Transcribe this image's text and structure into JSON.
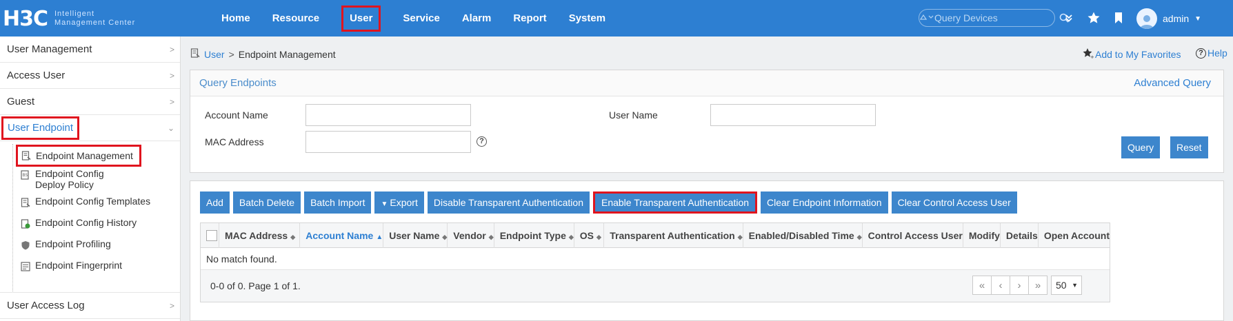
{
  "header": {
    "logo_main": "H3C",
    "logo_sub_line1": "Intelligent",
    "logo_sub_line2": "Management Center",
    "nav": [
      {
        "label": "Home",
        "active": false
      },
      {
        "label": "Resource",
        "active": false
      },
      {
        "label": "User",
        "active": true
      },
      {
        "label": "Service",
        "active": false
      },
      {
        "label": "Alarm",
        "active": false
      },
      {
        "label": "Report",
        "active": false
      },
      {
        "label": "System",
        "active": false
      }
    ],
    "search_placeholder": "Query Devices",
    "user": "admin"
  },
  "sidebar": {
    "menus_top": [
      {
        "label": "User Management"
      },
      {
        "label": "Access User"
      },
      {
        "label": "Guest"
      }
    ],
    "open_menu": {
      "label": "User Endpoint"
    },
    "sub_items": [
      {
        "label": "Endpoint Management",
        "selected": true
      },
      {
        "label": "Endpoint Config Deploy Policy"
      },
      {
        "label": "Endpoint Config Templates"
      },
      {
        "label": "Endpoint Config History"
      },
      {
        "label": "Endpoint Profiling"
      },
      {
        "label": "Endpoint Fingerprint"
      }
    ],
    "menus_bottom": [
      {
        "label": "User Access Log"
      }
    ]
  },
  "breadcrumb": {
    "root": "User",
    "separator": ">",
    "current": "Endpoint Management"
  },
  "links": {
    "favorites": "Add to My Favorites",
    "help": "Help"
  },
  "query": {
    "title": "Query Endpoints",
    "advanced": "Advanced Query",
    "account_name_label": "Account Name",
    "account_name_value": "",
    "user_name_label": "User Name",
    "user_name_value": "",
    "mac_label": "MAC Address",
    "mac_value": "",
    "help_glyph": "?",
    "query_btn": "Query",
    "reset_btn": "Reset"
  },
  "toolbar": {
    "add": "Add",
    "batch_delete": "Batch Delete",
    "batch_import": "Batch Import",
    "export": "Export",
    "disable_ta": "Disable Transparent Authentication",
    "enable_ta": "Enable Transparent Authentication",
    "clear_info": "Clear Endpoint Information",
    "clear_control": "Clear Control Access User"
  },
  "table": {
    "columns": [
      {
        "label": "MAC Address",
        "sortable": true,
        "sorted": false
      },
      {
        "label": "Account Name",
        "sortable": true,
        "sorted": true
      },
      {
        "label": "User Name",
        "sortable": true,
        "sorted": false
      },
      {
        "label": "Vendor",
        "sortable": true,
        "sorted": false
      },
      {
        "label": "Endpoint Type",
        "sortable": true,
        "sorted": false
      },
      {
        "label": "OS",
        "sortable": true,
        "sorted": false
      },
      {
        "label": "Transparent Authentication",
        "sortable": true,
        "sorted": false
      },
      {
        "label": "Enabled/Disabled Time",
        "sortable": true,
        "sorted": false
      },
      {
        "label": "Control Access User",
        "sortable": false,
        "sorted": false
      },
      {
        "label": "Modify",
        "sortable": false,
        "sorted": false
      },
      {
        "label": "Details",
        "sortable": false,
        "sorted": false
      },
      {
        "label": "Open Account",
        "sortable": false,
        "sorted": false
      }
    ],
    "empty_message": "No match found.",
    "pager_info": "0-0 of 0. Page 1 of 1.",
    "page_size": "50"
  },
  "colors": {
    "brand": "#2d7fd2",
    "button": "#3d86cc",
    "highlight": "#e0141e"
  }
}
